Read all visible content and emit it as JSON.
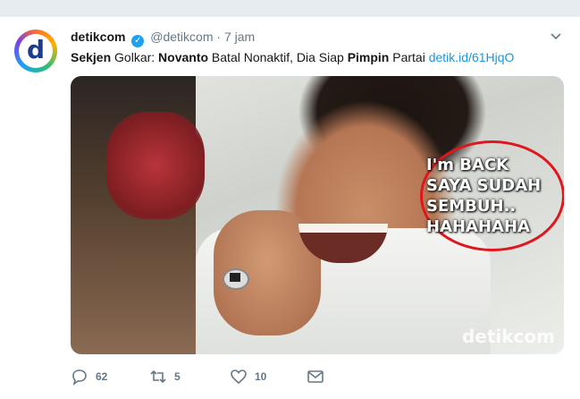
{
  "tweet": {
    "display_name": "detikcom",
    "handle": "@detikcom",
    "separator": "·",
    "time": "7 jam",
    "avatar_letter": "d",
    "text": {
      "part1": "Sekjen",
      "part2": " Golkar: ",
      "part3": "Novanto",
      "part4": " Batal Nonaktif, Dia Siap ",
      "part5": "Pimpin",
      "part6": " Partai ",
      "link": "detik.id/61HjqO"
    },
    "image": {
      "caption_lines": [
        "I'm BACK",
        "SAYA SUDAH",
        "SEMBUH..",
        "HAHAHAHA"
      ],
      "watermark": "detikcom"
    },
    "actions": {
      "replies": "62",
      "retweets": "5",
      "likes": "10"
    }
  },
  "colors": {
    "link": "#1b95e0",
    "verified": "#1da1f2",
    "circle": "#e0161e"
  }
}
